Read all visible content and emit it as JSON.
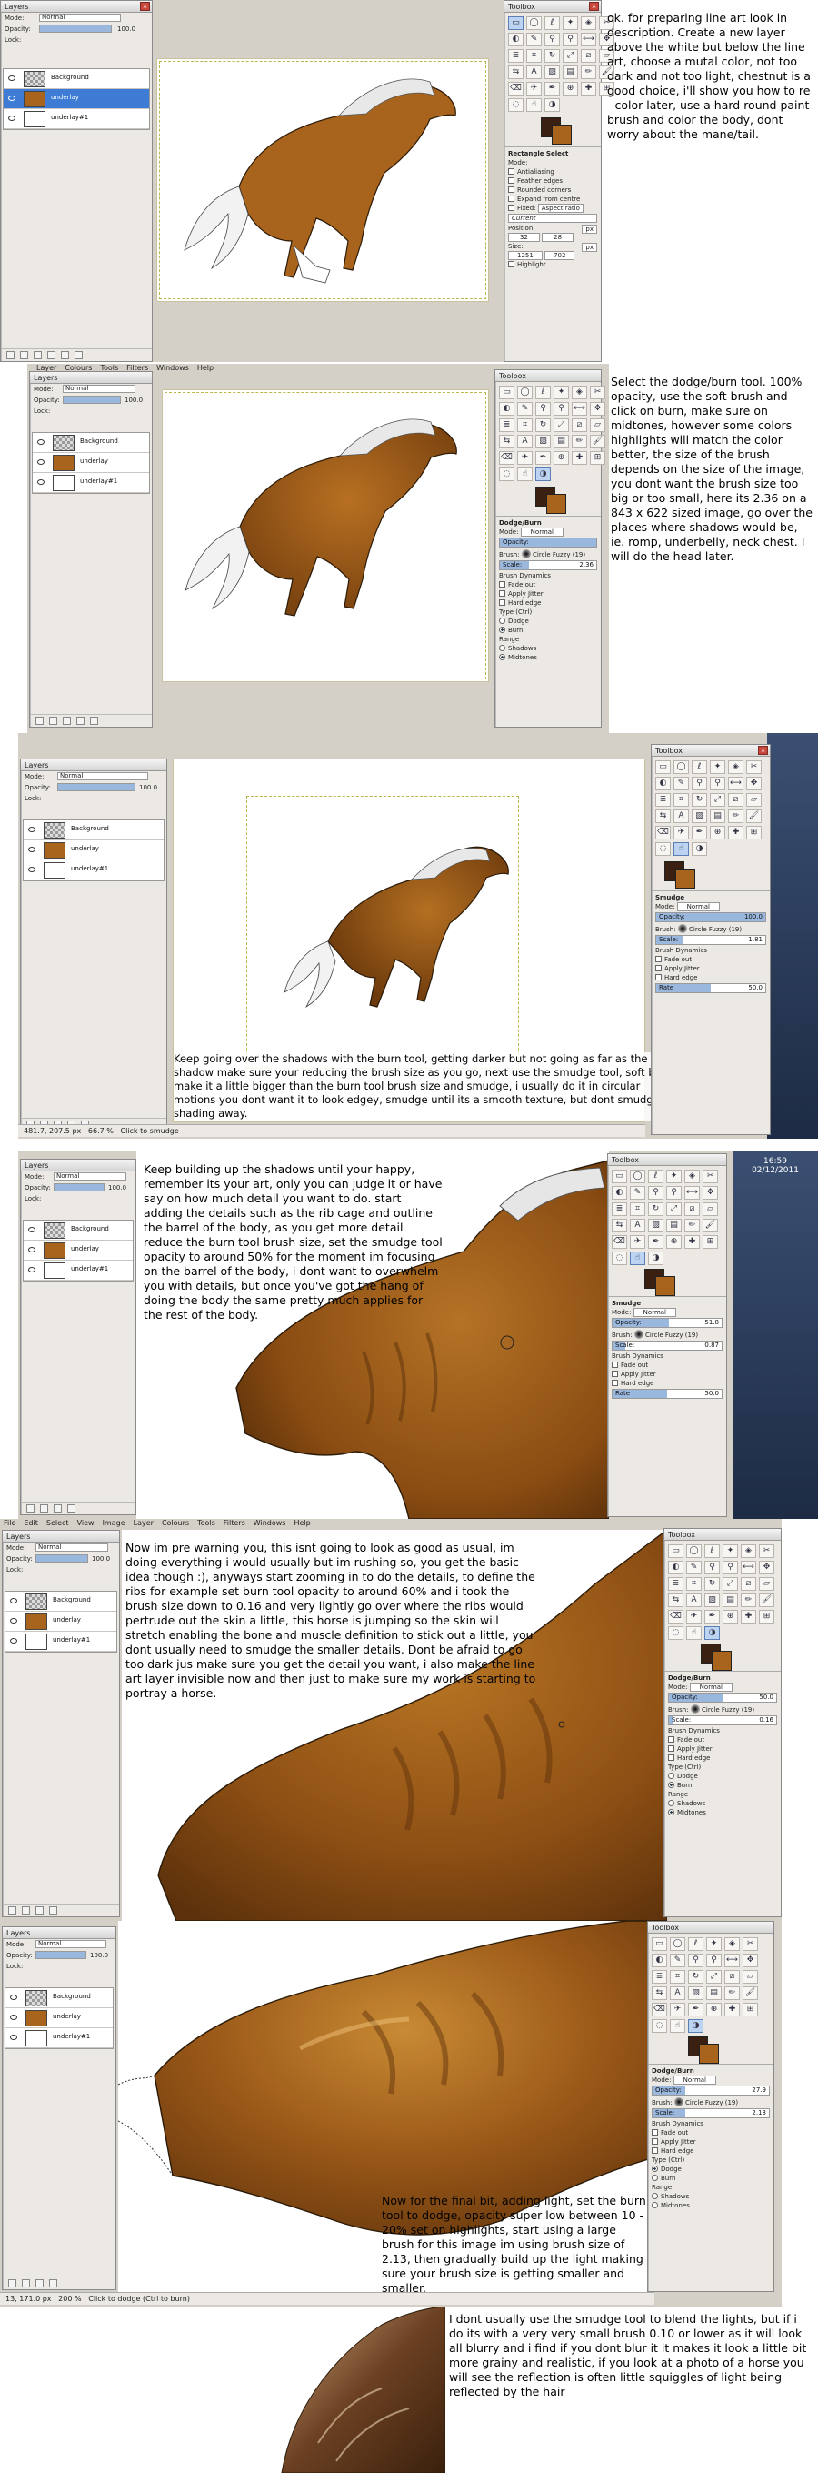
{
  "gimp": {
    "layers_title": "Layers",
    "toolbox_title": "Toolbox",
    "mode_label": "Mode:",
    "mode_value": "Normal",
    "opacity_label": "Opacity:",
    "opacity_value": "100.0",
    "lock_label": "Lock:",
    "layers": [
      "Background",
      "underlay",
      "underlay#1"
    ],
    "menu_items": [
      "Layer",
      "Colours",
      "Tools",
      "Filters",
      "Windows",
      "Help"
    ],
    "menu_items_full": [
      "File",
      "Edit",
      "Select",
      "View",
      "Image",
      "Layer",
      "Colours",
      "Tools",
      "Filters",
      "Windows",
      "Help"
    ]
  },
  "options": {
    "rect_title": "Rectangle Select",
    "rect_mode": "Mode:",
    "rect_items": [
      "Antialiasing",
      "Feather edges",
      "Rounded corners",
      "Expand from centre"
    ],
    "fixed": "Fixed:",
    "aspect": "Aspect ratio",
    "current": "Current",
    "position": "Position:",
    "px": "px",
    "pos_x": "32",
    "pos_y": "28",
    "size": "Size:",
    "size_w": "1251",
    "size_h": "702",
    "highlight": "Highlight",
    "dodge_title": "Dodge/Burn",
    "smudge_title": "Smudge",
    "brush_label": "Brush:",
    "brush_name": "Circle Fuzzy (19)",
    "scale_label": "Scale:",
    "rate_label": "Rate",
    "brush_dynamics": "Brush Dynamics",
    "fade_out": "Fade out",
    "apply_jitter": "Apply Jitter",
    "hard_edge": "Hard edge",
    "type_label": "Type (Ctrl)",
    "dodge": "Dodge",
    "burn": "Burn",
    "range_label": "Range",
    "shadows": "Shadows",
    "midtones": "Midtones",
    "s1_scale": "2.36",
    "s2_opacity": "100.0",
    "s2_scale": "1.81",
    "s2_rate": "50.0",
    "s3_opacity": "51.8",
    "s3_scale": "0.87",
    "s3_rate": "50.0",
    "s4_opacity": "50.0",
    "s4_scale": "0.16",
    "s5_opacity": "27.9",
    "s5_scale": "2.13"
  },
  "status": {
    "coords": "481.7, 207.5",
    "units": "px",
    "zoom1": "66.7 %",
    "msg1": "Click to smudge",
    "coords2": "13, 171.0",
    "zoom2": "200 %",
    "msg2": "Click to dodge (Ctrl to burn)",
    "clock_time": "16:59",
    "clock_date": "02/12/2011"
  },
  "steps": [
    "ok. for preparing line art look in description. Create a new layer above the white but below the line art, choose a mutal color, not too dark and not too light, chestnut is a good choice, i'll show you how to re - color later, use a hard round paint brush and color the body, dont worry about the mane/tail.",
    "Select the dodge/burn tool. 100% opacity,  use the soft brush and click on burn, make sure on midtones, however some colors highlights will match the color better, the size of the brush depends on the size of the image, you dont want the brush size too big or too small, here its 2.36 on a 843 x 622 sized image, go over the places where shadows would be, ie. romp, underbelly, neck chest. I will do the head later.",
    "Keep going over the shadows with the burn tool, getting darker but not going as far as the first shadow make sure your reducing the brush size as you go, next use the smudge tool, soft brush make it a little bigger than the burn tool brush size and smudge, i usually do it in circular motions you dont want it to look edgey, smudge until its a smooth texture, but dont smudge the shading away.",
    "Keep building up the shadows until your happy, remember its your art, only you can judge it or have say on how much detail you want to do. start adding the details such as the rib cage and outline the barrel of the body, as you get more detail reduce the burn tool brush size, set the smudge tool opacity to around 50% for the moment im focusing on the barrel of the body, i dont want to overwhelm you with details, but once you've got the hang of doing the body the same pretty much applies for the rest of the body.",
    "Now im pre warning you, this isnt going to look as good as usual, im doing everything i would usually but im rushing so, you get the basic idea though :), anyways start zooming in to do the details, to define the ribs for example set burn tool opacity to around 60% and i took the brush size down to 0.16 and very lightly go over where the ribs would pertrude out the skin a little, this horse is jumping so the skin will stretch enabling the bone and muscle definition to stick out a little, you dont usually need to smudge the smaller details. Dont be afraid to go too dark jus make sure you get the detail you want, i also make the line art layer invisible now and then just to make sure my work is starting to portray a horse.",
    "Now for the final bit, adding light, set the burn tool to dodge, opacity super low between 10 - 20% set on highlights, start using a large brush for this image im using brush size of 2.13, then gradually build up the light making sure your brush size is getting smaller and smaller.",
    "I dont usually use the smudge tool to blend the lights, but if i do its with a very very small brush 0.10 or lower as it will look all blurry and i find if you dont blur it it makes it look a little bit more grainy and realistic, if you look at a photo of a horse you will see the reflection is often little squiggles of light being reflected by the hair"
  ],
  "tool_icons": [
    "rect-select",
    "ellipse-select",
    "lasso",
    "fuzzy-select",
    "color-select",
    "scissors",
    "foreground-select",
    "paths",
    "color-picker",
    "zoom",
    "measure",
    "move",
    "align",
    "crop",
    "rotate",
    "scale",
    "shear",
    "perspective",
    "flip",
    "text",
    "bucket-fill",
    "blend",
    "pencil",
    "paintbrush",
    "eraser",
    "airbrush",
    "ink",
    "clone",
    "heal",
    "perspective-clone",
    "blur",
    "smudge",
    "dodge-burn"
  ],
  "colors": {
    "chestnut": "#a8641c",
    "dark": "#5a3210",
    "fg": "#3a2010",
    "bg": "#a8641c",
    "accent": "#3d7bd5"
  }
}
